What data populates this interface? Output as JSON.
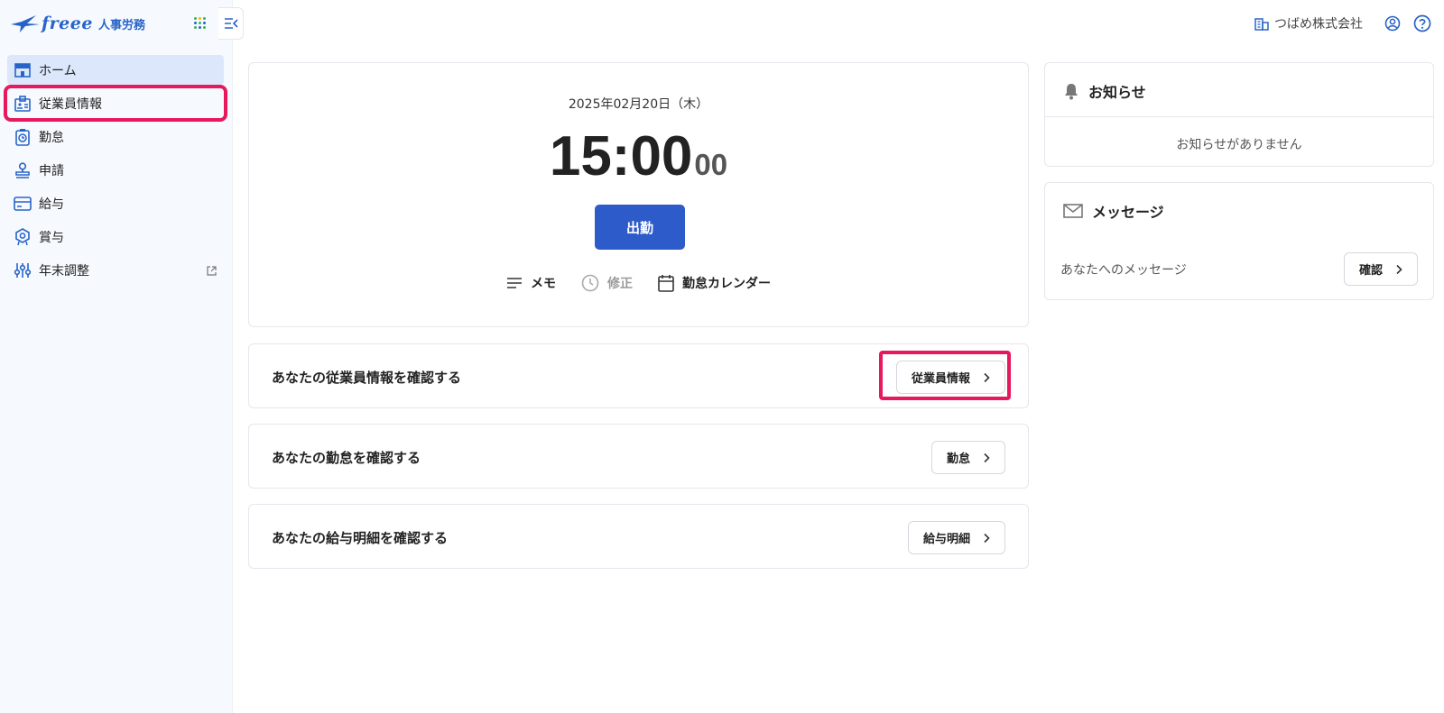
{
  "app": {
    "logo_text": "freee",
    "logo_sub": "人事労務"
  },
  "sidebar": {
    "items": [
      {
        "label": "ホーム",
        "icon": "home-icon",
        "active": true
      },
      {
        "label": "従業員情報",
        "icon": "id-card-icon",
        "highlighted": true
      },
      {
        "label": "勤怠",
        "icon": "clock-badge-icon"
      },
      {
        "label": "申請",
        "icon": "stamp-icon"
      },
      {
        "label": "給与",
        "icon": "card-icon"
      },
      {
        "label": "賞与",
        "icon": "award-icon"
      },
      {
        "label": "年末調整",
        "icon": "sliders-icon",
        "external": true
      }
    ]
  },
  "header": {
    "company": "つばめ株式会社"
  },
  "clock": {
    "date": "2025年02月20日（木）",
    "hm": "15:00",
    "sec": "00",
    "clock_in_label": "出勤",
    "actions": [
      {
        "label": "メモ",
        "icon": "memo-lines-icon",
        "disabled": false
      },
      {
        "label": "修正",
        "icon": "clock-icon",
        "disabled": true
      },
      {
        "label": "勤怠カレンダー",
        "icon": "calendar-icon",
        "disabled": false
      }
    ]
  },
  "rows": [
    {
      "text": "あなたの従業員情報を確認する",
      "button": "従業員情報"
    },
    {
      "text": "あなたの勤怠を確認する",
      "button": "勤怠"
    },
    {
      "text": "あなたの給与明細を確認する",
      "button": "給与明細"
    }
  ],
  "news": {
    "title": "お知らせ",
    "empty": "お知らせがありません"
  },
  "messages": {
    "title": "メッセージ",
    "label": "あなたへのメッセージ",
    "button": "確認"
  },
  "colors": {
    "primary": "#2d5bc9",
    "highlight": "#e8185c",
    "sidebar_bg": "#f6f9fd",
    "active_bg": "#dce7fb"
  }
}
